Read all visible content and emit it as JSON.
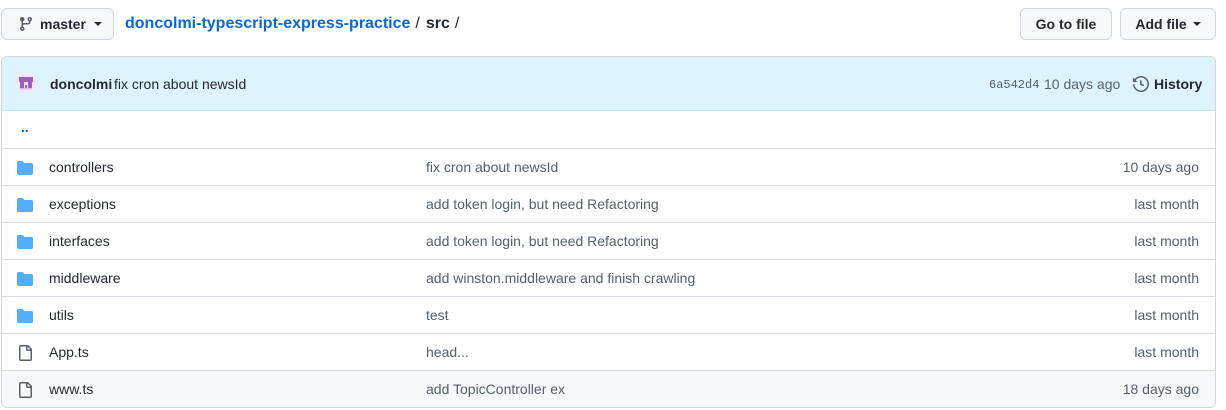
{
  "branch": {
    "name": "master",
    "icon": "git-branch-icon"
  },
  "breadcrumb": {
    "repo": "doncolmi-typescript-express-practice",
    "separator": "/",
    "dir": "src",
    "trailing": "/"
  },
  "actions": {
    "go_to_file": "Go to file",
    "add_file": "Add file"
  },
  "commit": {
    "author": "doncolmi",
    "message": "fix cron about newsId",
    "sha": "6a542d4",
    "time": "10 days ago",
    "history_label": "History"
  },
  "parent_dir": "..",
  "files": [
    {
      "type": "dir",
      "name": "controllers",
      "message": "fix cron about newsId",
      "age": "10 days ago"
    },
    {
      "type": "dir",
      "name": "exceptions",
      "message": "add token login, but need Refactoring",
      "age": "last month"
    },
    {
      "type": "dir",
      "name": "interfaces",
      "message": "add token login, but need Refactoring",
      "age": "last month"
    },
    {
      "type": "dir",
      "name": "middleware",
      "message": "add winston.middleware and finish crawling",
      "age": "last month"
    },
    {
      "type": "dir",
      "name": "utils",
      "message": "test",
      "age": "last month"
    },
    {
      "type": "file",
      "name": "App.ts",
      "message": "head...",
      "age": "last month"
    },
    {
      "type": "file",
      "name": "www.ts",
      "message": "add TopicController ex",
      "age": "18 days ago"
    }
  ],
  "colors": {
    "accent": "#0969da",
    "folder": "#54aeff",
    "commit_bar": "#ddf4ff"
  }
}
